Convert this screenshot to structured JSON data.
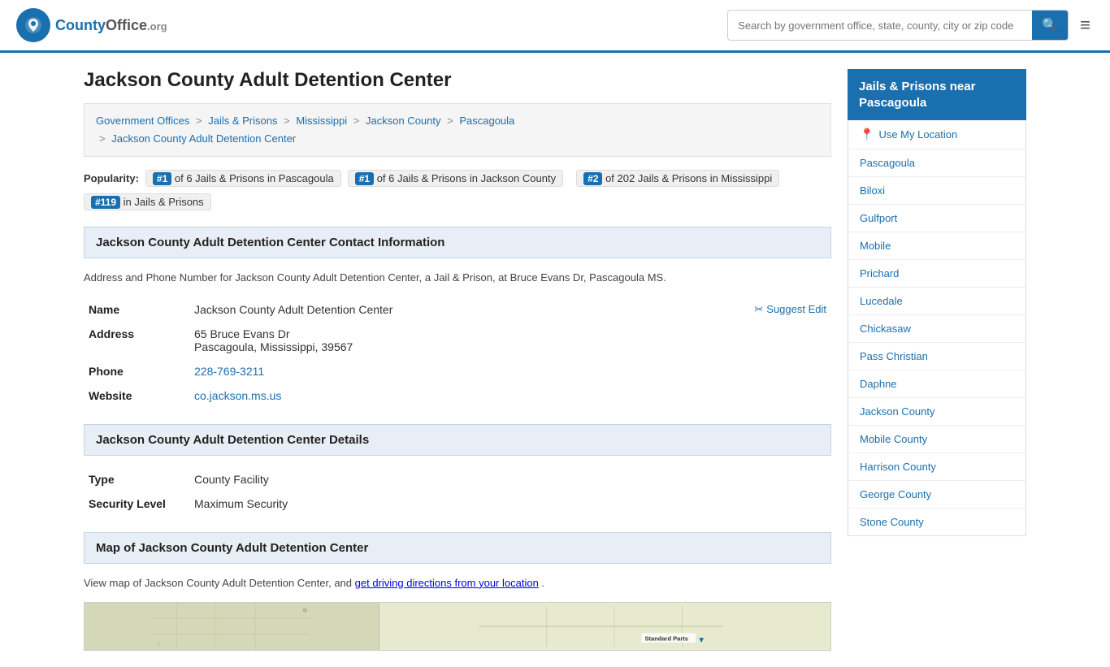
{
  "header": {
    "logo_text": "CountyOffice",
    "logo_suffix": ".org",
    "search_placeholder": "Search by government office, state, county, city or zip code",
    "search_icon": "🔍",
    "menu_icon": "≡"
  },
  "page": {
    "title": "Jackson County Adult Detention Center",
    "breadcrumbs": [
      {
        "label": "Government Offices",
        "href": "#"
      },
      {
        "label": "Jails & Prisons",
        "href": "#"
      },
      {
        "label": "Mississippi",
        "href": "#"
      },
      {
        "label": "Jackson County",
        "href": "#"
      },
      {
        "label": "Pascagoula",
        "href": "#"
      },
      {
        "label": "Jackson County Adult Detention Center",
        "href": "#"
      }
    ],
    "popularity": {
      "label": "Popularity:",
      "items": [
        {
          "rank": "#1",
          "text": "of 6 Jails & Prisons in Pascagoula"
        },
        {
          "rank": "#1",
          "text": "of 6 Jails & Prisons in Jackson County"
        },
        {
          "rank": "#2",
          "text": "of 202 Jails & Prisons in Mississippi"
        },
        {
          "rank": "#119",
          "text": "in Jails & Prisons"
        }
      ]
    },
    "contact_section": {
      "header": "Jackson County Adult Detention Center Contact Information",
      "description": "Address and Phone Number for Jackson County Adult Detention Center, a Jail & Prison, at Bruce Evans Dr, Pascagoula MS.",
      "suggest_edit_label": "Suggest Edit",
      "name_label": "Name",
      "name_value": "Jackson County Adult Detention Center",
      "address_label": "Address",
      "address_line1": "65 Bruce Evans Dr",
      "address_line2": "Pascagoula, Mississippi, 39567",
      "phone_label": "Phone",
      "phone_value": "228-769-3211",
      "website_label": "Website",
      "website_value": "co.jackson.ms.us"
    },
    "details_section": {
      "header": "Jackson County Adult Detention Center Details",
      "type_label": "Type",
      "type_value": "County Facility",
      "security_label": "Security Level",
      "security_value": "Maximum Security"
    },
    "map_section": {
      "header": "Map of Jackson County Adult Detention Center",
      "description": "View map of Jackson County Adult Detention Center, and ",
      "driving_link": "get driving directions from your location",
      "driving_suffix": ".",
      "map_label": "Standard Parts"
    }
  },
  "sidebar": {
    "header": "Jails & Prisons near Pascagoula",
    "use_my_location": "Use My Location",
    "items": [
      {
        "label": "Pascagoula",
        "href": "#"
      },
      {
        "label": "Biloxi",
        "href": "#"
      },
      {
        "label": "Gulfport",
        "href": "#"
      },
      {
        "label": "Mobile",
        "href": "#"
      },
      {
        "label": "Prichard",
        "href": "#"
      },
      {
        "label": "Lucedale",
        "href": "#"
      },
      {
        "label": "Chickasaw",
        "href": "#"
      },
      {
        "label": "Pass Christian",
        "href": "#"
      },
      {
        "label": "Daphne",
        "href": "#"
      },
      {
        "label": "Jackson County",
        "href": "#"
      },
      {
        "label": "Mobile County",
        "href": "#"
      },
      {
        "label": "Harrison County",
        "href": "#"
      },
      {
        "label": "George County",
        "href": "#"
      },
      {
        "label": "Stone County",
        "href": "#"
      }
    ]
  }
}
